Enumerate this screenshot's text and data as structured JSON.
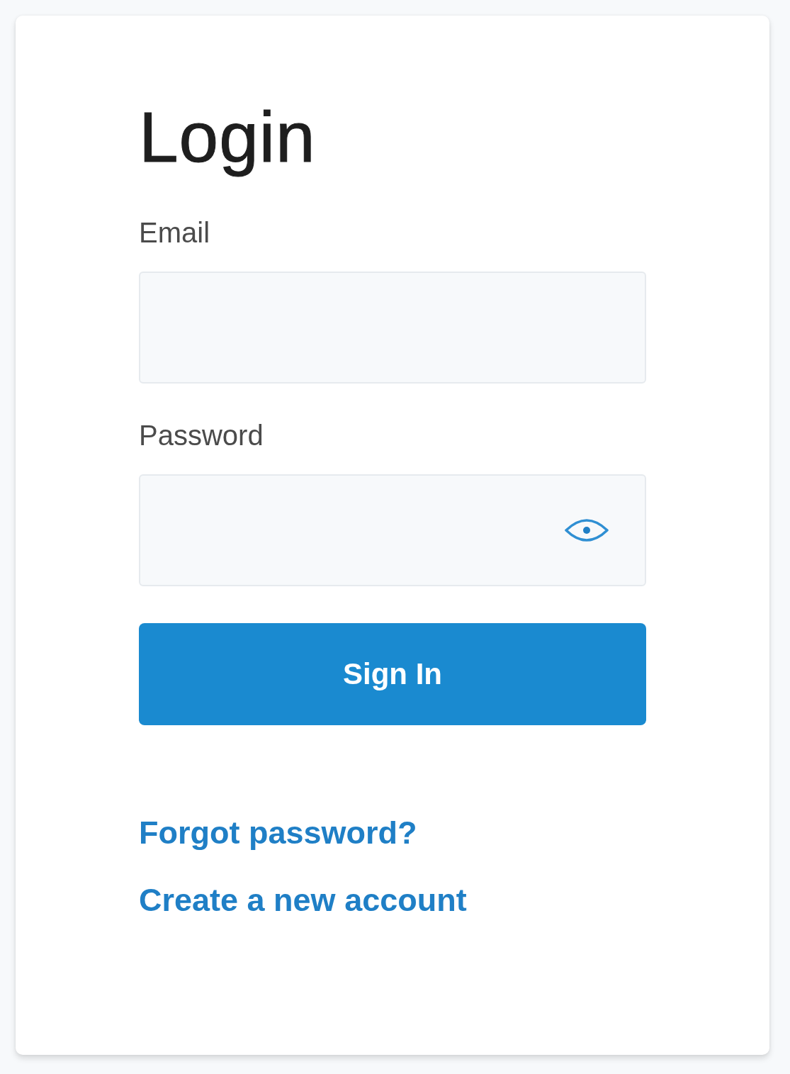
{
  "card": {
    "title": "Login"
  },
  "fields": [
    {
      "kind": "email",
      "label": "Email"
    },
    {
      "kind": "password",
      "label": "Password"
    }
  ],
  "submit": {
    "label": "Sign In"
  },
  "links": [
    {
      "label": "Forgot password?"
    },
    {
      "label": "Create a new account"
    }
  ]
}
